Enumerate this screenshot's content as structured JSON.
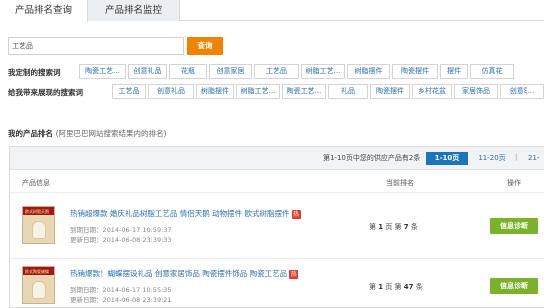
{
  "tabs": [
    {
      "label": "产品排名查询",
      "active": true
    },
    {
      "label": "产品排名监控",
      "active": false
    }
  ],
  "search": {
    "value": "工艺品",
    "button": "查询"
  },
  "my_keywords": {
    "label": "我定制的搜索词",
    "items": [
      "陶瓷工艺...",
      "创意礼品",
      "花瓶",
      "创意家居",
      "工艺品",
      "树脂工艺...",
      "树脂摆件",
      "陶瓷摆件",
      "摆件",
      "仿真花"
    ]
  },
  "recommended_keywords": {
    "label": "给我带来展现的搜索词",
    "items": [
      "工艺品",
      "创意礼品",
      "树脂摆件",
      "树脂工艺...",
      "陶瓷工艺...",
      "礼品",
      "陶瓷摆件",
      "乡村花盆",
      "家居饰品",
      "创意ξ..."
    ]
  },
  "ranking": {
    "title": "我的产品排名",
    "note": "(阿里巴巴网站搜索结果内的排名)",
    "pager_info": "第1-10页中您的供应产品有2条",
    "pages": [
      "1-10页",
      "11-20页",
      "21-"
    ],
    "columns": [
      "产品信息",
      "当前排名",
      "操作"
    ],
    "rows": [
      {
        "title": "热销超爆款  婚庆礼品树脂工艺品  情侣天鹅  动物摆件  欧式树脂摆件",
        "hot": "热",
        "expire": "到期日期：2014-06-17 10:59:37",
        "update": "更新日期：2014-06-08 23:39:33",
        "rank_page": "1",
        "rank_item": "7",
        "action": "信息诊断",
        "thumb_text": "欧式树脂天鹅"
      },
      {
        "title": "热销爆款！蝴蝶摆设礼品  创意家居饰品  陶瓷摆件饰品  陶瓷工艺品",
        "hot": "热",
        "expire": "到期日期：2014-06-17 10:55:35",
        "update": "更新日期：2014-06-08 23:39:21",
        "rank_page": "1",
        "rank_item": "47",
        "action": "信息诊断",
        "thumb_text": "欧式陶瓷蝴蝶"
      }
    ]
  },
  "colors": {
    "accent": "#f08300",
    "link": "#2a6fb0",
    "pager_active": "#1b75bb",
    "action": "#7cb22b",
    "hot": "#e23b2e"
  }
}
